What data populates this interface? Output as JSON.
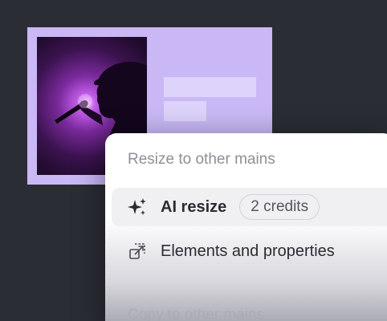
{
  "canvas": {
    "card_color": "#c9b8f5"
  },
  "menu": {
    "resize_section_title": "Resize to other mains",
    "copy_section_title": "Copy to other mains",
    "items": [
      {
        "label": "AI resize",
        "icon": "sparkles-icon",
        "badge": "2 credits"
      },
      {
        "label": "Elements and properties",
        "icon": "resize-arrow-icon"
      }
    ]
  },
  "colors": {
    "background": "#2b2d35",
    "accent_lavender": "#c9b8f5"
  }
}
